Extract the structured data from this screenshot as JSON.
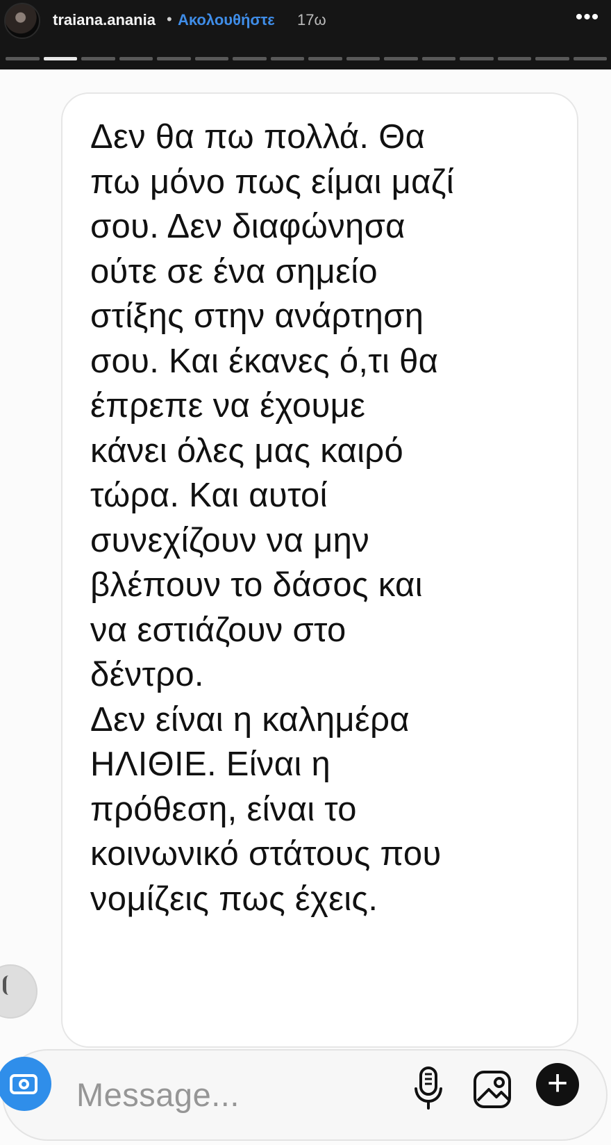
{
  "header": {
    "username": "traiana.anania",
    "separator": "•",
    "follow_label": "Ακολουθήστε",
    "timestamp": "17ω",
    "more_icon": "more-options-icon"
  },
  "progress": {
    "total_segments": 16,
    "active_segment": 1
  },
  "message_card": {
    "lines": [
      "Δεν θα πω πολλά. Θα",
      "πω μόνο πως είμαι μαζί",
      "σου. Δεν διαφώνησα",
      "ούτε σε ένα σημείο",
      "στίξης στην ανάρτηση",
      "σου. Και έκανες ό,τι θα",
      "έπρεπε να έχουμε",
      "κάνει όλες μας καιρό",
      "τώρα. Και αυτοί",
      "συνεχίζουν να μην",
      "βλέπουν το δάσος και",
      "να εστιάζουν στο",
      "δέντρο.",
      "Δεν είναι η καλημέρα",
      "ΗΛΙΘΙΕ. Είναι η",
      "πρόθεση, είναι το",
      "κοινωνικό στάτους που",
      "νομίζεις πως έχεις."
    ]
  },
  "composer": {
    "placeholder": "Message...",
    "camera_icon": "camera-icon",
    "microphone_icon": "microphone-icon",
    "gallery_icon": "gallery-icon",
    "add_icon": "add-icon"
  },
  "colors": {
    "top_bar": "#151515",
    "follow": "#3f8de8",
    "camera": "#2f8eea",
    "message_text": "#111111"
  }
}
